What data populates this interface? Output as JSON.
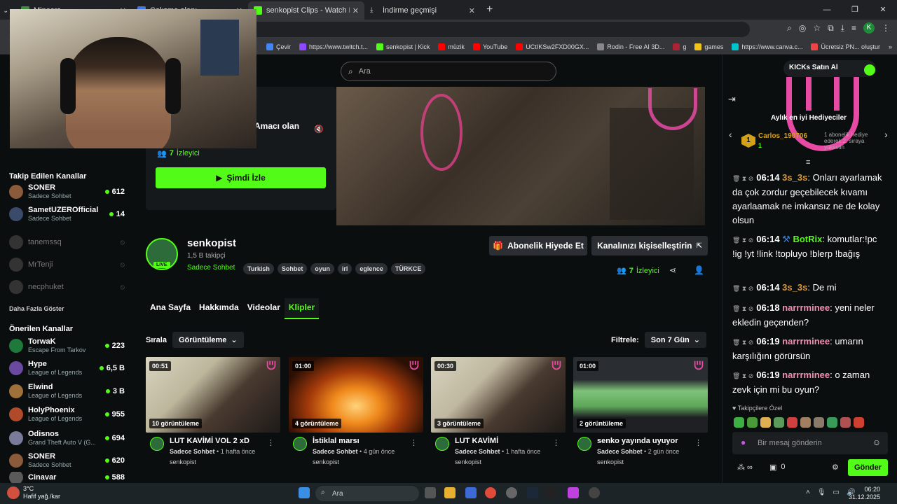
{
  "browser": {
    "tabs": [
      {
        "title": "Minecra",
        "fav_color": "#3c8c3c"
      },
      {
        "title": "Çalışma alanı",
        "fav_color": "#4477dd"
      },
      {
        "title": "senkopist Clips - Watch Live on",
        "fav_color": "#53fc18"
      },
      {
        "title": "İndirme geçmişi",
        "fav_color": "#cccccc"
      }
    ],
    "new_tab": "+",
    "bookmarks": [
      {
        "label": "Çevir",
        "color": "#4285f4"
      },
      {
        "label": "https://www.twitch.t...",
        "color": "#9146ff"
      },
      {
        "label": "senkopist | Kick",
        "color": "#53fc18"
      },
      {
        "label": "müzik",
        "color": "#ff0000"
      },
      {
        "label": "YouTube",
        "color": "#ff0000"
      },
      {
        "label": "UCtIKSw2FXD00GX...",
        "color": "#ff0000"
      },
      {
        "label": "Rodin - Free AI 3D...",
        "color": "#888888"
      },
      {
        "label": "g",
        "color": "#aa2233"
      },
      {
        "label": "games",
        "color": "#f0c419"
      },
      {
        "label": "https://www.canva.c...",
        "color": "#00c4cc"
      },
      {
        "label": "Ücretsiz PN... oluştur",
        "color": "#e44"
      }
    ],
    "profile_initial": "K"
  },
  "site": {
    "search_placeholder": "Ara",
    "buy_kicks": "KICKs Satın Al"
  },
  "sidebar": {
    "followed_title": "Takip Edilen Kanallar",
    "followed": [
      {
        "name": "SONER",
        "sub": "Sadece Sohbet",
        "count": "612",
        "color": "#8a5a3a"
      },
      {
        "name": "SametUZEROfficial",
        "sub": "Sadece Sohbet",
        "count": "14",
        "color": "#3a4a6a"
      }
    ],
    "offline": [
      {
        "name": "tanemssq"
      },
      {
        "name": "MrTenji"
      },
      {
        "name": "necphuket"
      }
    ],
    "show_more": "Daha Fazla Göster",
    "recommended_title": "Önerilen Kanallar",
    "recommended": [
      {
        "name": "TorwaK",
        "sub": "Escape From Tarkov",
        "count": "223",
        "color": "#1e7a3a"
      },
      {
        "name": "Hype",
        "sub": "League of Legends",
        "count": "6,5 B",
        "color": "#6a4aa0"
      },
      {
        "name": "Elwind",
        "sub": "League of Legends",
        "count": "3 B",
        "color": "#a0703a"
      },
      {
        "name": "HolyPhoenix",
        "sub": "League of Legends",
        "count": "955",
        "color": "#b04a2a"
      },
      {
        "name": "Odisnos",
        "sub": "Grand Theft Auto V (G...",
        "count": "694",
        "color": "#7a7a9a"
      },
      {
        "name": "SONER",
        "sub": "Sadece Sohbet",
        "count": "620",
        "color": "#8a5a3a"
      },
      {
        "name": "Cinavar",
        "sub": "",
        "count": "588",
        "color": "#5a5a5a"
      }
    ]
  },
  "hero": {
    "desc_fragment": "Amacı olan",
    "viewers": "7",
    "viewers_label": "İzleyici",
    "watch_now": "Şimdi İzle"
  },
  "channel": {
    "name": "senkopist",
    "followers": "1,5 B takipçi",
    "category": "Sadece Sohbet",
    "live_label": "LIVE",
    "tags": [
      "Turkish",
      "Sohbet",
      "oyun",
      "irl",
      "eglence",
      "TÜRKCE"
    ],
    "gift_sub": "Abonelik Hiyede Et",
    "customize": "Kanalınızı kişiselleştirin",
    "viewers": "7",
    "viewers_label": "İzleyici"
  },
  "tabs": [
    {
      "label": "Ana Sayfa",
      "active": false
    },
    {
      "label": "Hakkımda",
      "active": false
    },
    {
      "label": "Videolar",
      "active": false
    },
    {
      "label": "Klipler",
      "active": true
    }
  ],
  "sort": {
    "label": "Sırala",
    "value": "Görüntüleme"
  },
  "filter": {
    "label": "Filtrele:",
    "value": "Son 7 Gün"
  },
  "clips": [
    {
      "duration": "00:51",
      "views": "10 görüntüleme",
      "title": "LUT KAVİMİ VOL 2 xD",
      "category": "Sadece Sohbet",
      "age": "1 hafta önce",
      "user": "senkopist",
      "bg": "linear-gradient(135deg,#d8d4c0 0%,#bdb79c 35%,#4a3a30 60%,#1d1a18 100%)"
    },
    {
      "duration": "01:00",
      "views": "4 görüntüleme",
      "title": "İstiklal marsı",
      "category": "Sadece Sohbet",
      "age": "4 gün önce",
      "user": "senkopist",
      "bg": "radial-gradient(ellipse at 50% 65%,#ffd27a 0%,#f08a1c 25%,#a33a0a 50%,#2a0f05 80%)"
    },
    {
      "duration": "00:30",
      "views": "3 görüntüleme",
      "title": "LUT KAVİMİ",
      "category": "Sadece Sohbet",
      "age": "1 hafta önce",
      "user": "senkopist",
      "bg": "linear-gradient(135deg,#d8d4c0 0%,#c0b8a0 35%,#4a3a30 60%,#1d1a18 100%)"
    },
    {
      "duration": "01:00",
      "views": "2 görüntüleme",
      "title": "senko yayında uyuyor",
      "category": "Sadece Sohbet",
      "age": "2 gün önce",
      "user": "senkopist",
      "bg": "linear-gradient(180deg,#2a2d31 0%,#2a2d31 30%,#7ec27a 45%,#5ea85a 65%,#1e2024 80%)"
    }
  ],
  "chat": {
    "gifters_title": "Aylık en iyi Hediyeciler",
    "top_gifter": {
      "rank": "1",
      "name": "Carlos_190706",
      "count": "1",
      "info": "1 abonelik hediye ederek 2. sıraya yükselin"
    },
    "messages": [
      {
        "time": "06:14",
        "user": "3s_3s",
        "cls": "u1",
        "text": "Onları ayarlamak da çok zordur geçebilecek kıvamı ayarlaamak ne imkansız ne de kolay olsun"
      },
      {
        "time": "06:14",
        "user": "BotRix",
        "cls": "u2",
        "text": "komutlar:!pc !ig !yt !link !topluyo !blerp !bağış"
      },
      {
        "time": "06:14",
        "user": "3s_3s",
        "cls": "u1",
        "text": "De mi"
      },
      {
        "time": "06:18",
        "user": "narrrminee",
        "cls": "u3",
        "text": "yeni neler ekledin geçenden?"
      },
      {
        "time": "06:19",
        "user": "narrrminee",
        "cls": "u3",
        "text": "umarın karşılığını görürsün"
      },
      {
        "time": "06:19",
        "user": "narrrminee",
        "cls": "u3",
        "text": "o zaman zevk için mi bu oyun?"
      }
    ],
    "followers_only": "Takipçilere Özel",
    "input_placeholder": "Bir mesaj gönderin",
    "points": "0",
    "send": "Gönder",
    "emote_colors": [
      "#3cb043",
      "#4a9a3a",
      "#e0b050",
      "#5a9a5a",
      "#d04040",
      "#a08060",
      "#8a7a6a",
      "#3a9a5a",
      "#b05050",
      "#d04030"
    ]
  },
  "taskbar": {
    "temp": "3°C",
    "weather": "Hafif yağ./kar",
    "search": "Ara",
    "time": "06:20",
    "date": "31.12.2025"
  }
}
